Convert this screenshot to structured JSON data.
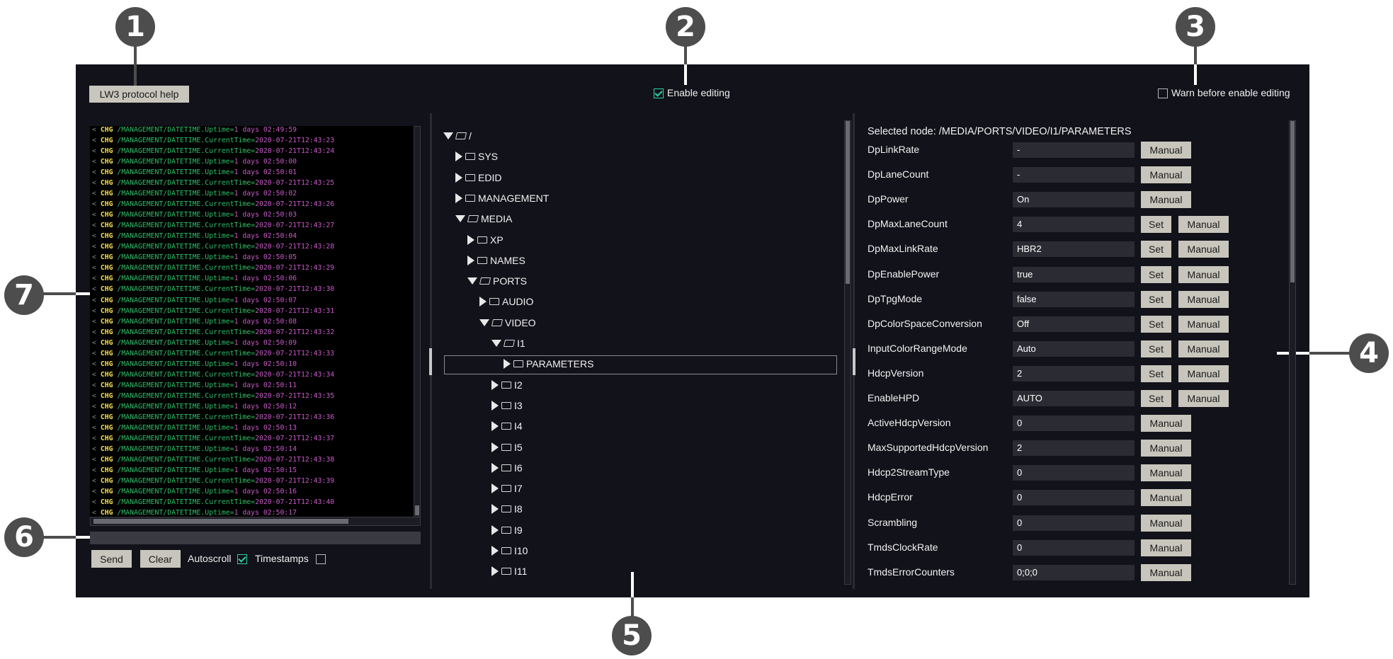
{
  "callouts": [
    "1",
    "2",
    "3",
    "4",
    "5",
    "6",
    "7"
  ],
  "toolbar": {
    "help_label": "LW3 protocol help",
    "enable_editing_label": "Enable editing",
    "enable_editing_checked": true,
    "warn_label": "Warn before enable editing",
    "warn_checked": false
  },
  "console": {
    "lines": [
      [
        "<",
        "CHG",
        "/MANAGEMENT/DATETIME.Uptime=",
        "1 days 02:49:59"
      ],
      [
        "<",
        "CHG",
        "/MANAGEMENT/DATETIME.CurrentTime=",
        "2020-07-21T12:43:23"
      ],
      [
        "<",
        "CHG",
        "/MANAGEMENT/DATETIME.CurrentTime=",
        "2020-07-21T12:43:24"
      ],
      [
        "<",
        "CHG",
        "/MANAGEMENT/DATETIME.Uptime=",
        "1 days 02:50:00"
      ],
      [
        "<",
        "CHG",
        "/MANAGEMENT/DATETIME.Uptime=",
        "1 days 02:50:01"
      ],
      [
        "<",
        "CHG",
        "/MANAGEMENT/DATETIME.CurrentTime=",
        "2020-07-21T12:43:25"
      ],
      [
        "<",
        "CHG",
        "/MANAGEMENT/DATETIME.Uptime=",
        "1 days 02:50:02"
      ],
      [
        "<",
        "CHG",
        "/MANAGEMENT/DATETIME.CurrentTime=",
        "2020-07-21T12:43:26"
      ],
      [
        "<",
        "CHG",
        "/MANAGEMENT/DATETIME.Uptime=",
        "1 days 02:50:03"
      ],
      [
        "<",
        "CHG",
        "/MANAGEMENT/DATETIME.CurrentTime=",
        "2020-07-21T12:43:27"
      ],
      [
        "<",
        "CHG",
        "/MANAGEMENT/DATETIME.Uptime=",
        "1 days 02:50:04"
      ],
      [
        "<",
        "CHG",
        "/MANAGEMENT/DATETIME.CurrentTime=",
        "2020-07-21T12:43:28"
      ],
      [
        "<",
        "CHG",
        "/MANAGEMENT/DATETIME.Uptime=",
        "1 days 02:50:05"
      ],
      [
        "<",
        "CHG",
        "/MANAGEMENT/DATETIME.CurrentTime=",
        "2020-07-21T12:43:29"
      ],
      [
        "<",
        "CHG",
        "/MANAGEMENT/DATETIME.Uptime=",
        "1 days 02:50:06"
      ],
      [
        "<",
        "CHG",
        "/MANAGEMENT/DATETIME.CurrentTime=",
        "2020-07-21T12:43:30"
      ],
      [
        "<",
        "CHG",
        "/MANAGEMENT/DATETIME.Uptime=",
        "1 days 02:50:07"
      ],
      [
        "<",
        "CHG",
        "/MANAGEMENT/DATETIME.CurrentTime=",
        "2020-07-21T12:43:31"
      ],
      [
        "<",
        "CHG",
        "/MANAGEMENT/DATETIME.Uptime=",
        "1 days 02:50:08"
      ],
      [
        "<",
        "CHG",
        "/MANAGEMENT/DATETIME.CurrentTime=",
        "2020-07-21T12:43:32"
      ],
      [
        "<",
        "CHG",
        "/MANAGEMENT/DATETIME.Uptime=",
        "1 days 02:50:09"
      ],
      [
        "<",
        "CHG",
        "/MANAGEMENT/DATETIME.CurrentTime=",
        "2020-07-21T12:43:33"
      ],
      [
        "<",
        "CHG",
        "/MANAGEMENT/DATETIME.Uptime=",
        "1 days 02:50:10"
      ],
      [
        "<",
        "CHG",
        "/MANAGEMENT/DATETIME.CurrentTime=",
        "2020-07-21T12:43:34"
      ],
      [
        "<",
        "CHG",
        "/MANAGEMENT/DATETIME.Uptime=",
        "1 days 02:50:11"
      ],
      [
        "<",
        "CHG",
        "/MANAGEMENT/DATETIME.CurrentTime=",
        "2020-07-21T12:43:35"
      ],
      [
        "<",
        "CHG",
        "/MANAGEMENT/DATETIME.Uptime=",
        "1 days 02:50:12"
      ],
      [
        "<",
        "CHG",
        "/MANAGEMENT/DATETIME.CurrentTime=",
        "2020-07-21T12:43:36"
      ],
      [
        "<",
        "CHG",
        "/MANAGEMENT/DATETIME.Uptime=",
        "1 days 02:50:13"
      ],
      [
        "<",
        "CHG",
        "/MANAGEMENT/DATETIME.CurrentTime=",
        "2020-07-21T12:43:37"
      ],
      [
        "<",
        "CHG",
        "/MANAGEMENT/DATETIME.Uptime=",
        "1 days 02:50:14"
      ],
      [
        "<",
        "CHG",
        "/MANAGEMENT/DATETIME.CurrentTime=",
        "2020-07-21T12:43:38"
      ],
      [
        "<",
        "CHG",
        "/MANAGEMENT/DATETIME.Uptime=",
        "1 days 02:50:15"
      ],
      [
        "<",
        "CHG",
        "/MANAGEMENT/DATETIME.CurrentTime=",
        "2020-07-21T12:43:39"
      ],
      [
        "<",
        "CHG",
        "/MANAGEMENT/DATETIME.Uptime=",
        "1 days 02:50:16"
      ],
      [
        "<",
        "CHG",
        "/MANAGEMENT/DATETIME.CurrentTime=",
        "2020-07-21T12:43:40"
      ],
      [
        "<",
        "CHG",
        "/MANAGEMENT/DATETIME.Uptime=",
        "1 days 02:50:17"
      ]
    ],
    "command_value": "",
    "send_label": "Send",
    "clear_label": "Clear",
    "autoscroll_label": "Autoscroll",
    "autoscroll_checked": true,
    "timestamps_label": "Timestamps",
    "timestamps_checked": false
  },
  "tree": {
    "items": [
      {
        "label": "/",
        "depth": 0,
        "expanded": true
      },
      {
        "label": "SYS",
        "depth": 1,
        "expanded": false
      },
      {
        "label": "EDID",
        "depth": 1,
        "expanded": false
      },
      {
        "label": "MANAGEMENT",
        "depth": 1,
        "expanded": false
      },
      {
        "label": "MEDIA",
        "depth": 1,
        "expanded": true
      },
      {
        "label": "XP",
        "depth": 2,
        "expanded": false
      },
      {
        "label": "NAMES",
        "depth": 2,
        "expanded": false
      },
      {
        "label": "PORTS",
        "depth": 2,
        "expanded": true
      },
      {
        "label": "AUDIO",
        "depth": 3,
        "expanded": false
      },
      {
        "label": "VIDEO",
        "depth": 3,
        "expanded": true
      },
      {
        "label": "I1",
        "depth": 4,
        "expanded": true
      },
      {
        "label": "PARAMETERS",
        "depth": 5,
        "expanded": false,
        "selected": true
      },
      {
        "label": "I2",
        "depth": 4,
        "expanded": false
      },
      {
        "label": "I3",
        "depth": 4,
        "expanded": false
      },
      {
        "label": "I4",
        "depth": 4,
        "expanded": false
      },
      {
        "label": "I5",
        "depth": 4,
        "expanded": false
      },
      {
        "label": "I6",
        "depth": 4,
        "expanded": false
      },
      {
        "label": "I7",
        "depth": 4,
        "expanded": false
      },
      {
        "label": "I8",
        "depth": 4,
        "expanded": false
      },
      {
        "label": "I9",
        "depth": 4,
        "expanded": false
      },
      {
        "label": "I10",
        "depth": 4,
        "expanded": false
      },
      {
        "label": "I11",
        "depth": 4,
        "expanded": false
      }
    ]
  },
  "params": {
    "selected_node": "Selected node: /MEDIA/PORTS/VIDEO/I1/PARAMETERS",
    "set_label": "Set",
    "manual_label": "Manual",
    "rows": [
      {
        "name": "DpLinkRate",
        "value": "-",
        "settable": false
      },
      {
        "name": "DpLaneCount",
        "value": "-",
        "settable": false
      },
      {
        "name": "DpPower",
        "value": "On",
        "settable": false
      },
      {
        "name": "DpMaxLaneCount",
        "value": "4",
        "settable": true
      },
      {
        "name": "DpMaxLinkRate",
        "value": "HBR2",
        "settable": true
      },
      {
        "name": "DpEnablePower",
        "value": "true",
        "settable": true
      },
      {
        "name": "DpTpgMode",
        "value": "false",
        "settable": true
      },
      {
        "name": "DpColorSpaceConversion",
        "value": "Off",
        "settable": true
      },
      {
        "name": "InputColorRangeMode",
        "value": "Auto",
        "settable": true
      },
      {
        "name": "HdcpVersion",
        "value": "2",
        "settable": true
      },
      {
        "name": "EnableHPD",
        "value": "AUTO",
        "settable": true
      },
      {
        "name": "ActiveHdcpVersion",
        "value": "0",
        "settable": false
      },
      {
        "name": "MaxSupportedHdcpVersion",
        "value": "2",
        "settable": false
      },
      {
        "name": "Hdcp2StreamType",
        "value": "0",
        "settable": false
      },
      {
        "name": "HdcpError",
        "value": "0",
        "settable": false
      },
      {
        "name": "Scrambling",
        "value": "0",
        "settable": false
      },
      {
        "name": "TmdsClockRate",
        "value": "0",
        "settable": false
      },
      {
        "name": "TmdsErrorCounters",
        "value": "0;0;0",
        "settable": false
      }
    ]
  },
  "colors": {
    "background": "#12121a",
    "accent_check": "#2ed3a3",
    "button": "#c8c6bc",
    "field": "#2b2b33",
    "log_keyword": "#f5e04a",
    "log_path": "#2fbf6a",
    "log_value": "#c85ac8",
    "callout": "#4d4d4d"
  }
}
